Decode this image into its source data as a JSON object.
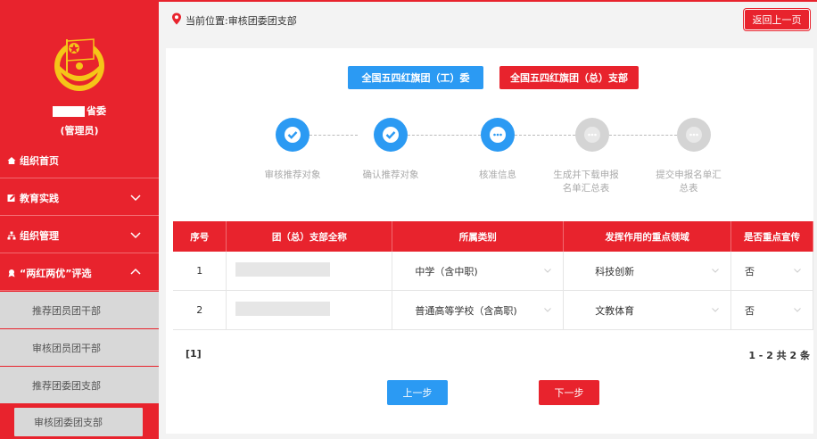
{
  "sidebar": {
    "user_suffix": "省委",
    "user_role": "(管理员)",
    "items": [
      {
        "label": "组织首页",
        "icon": "home-icon"
      },
      {
        "label": "教育实践",
        "icon": "edit-icon"
      },
      {
        "label": "组织管理",
        "icon": "org-icon"
      },
      {
        "label": "“两红两优”评选",
        "icon": "award-icon"
      }
    ],
    "sub_items": [
      {
        "label": "推荐团员团干部"
      },
      {
        "label": "审核团员团干部"
      },
      {
        "label": "推荐团委团支部"
      },
      {
        "label": "审核团委团支部"
      }
    ],
    "colors": {
      "brand": "#e8232d",
      "sub_bg": "#d8d8d8"
    }
  },
  "topbar": {
    "breadcrumb": "当前位置:审核团委团支部",
    "back_label": "返回上一页"
  },
  "toggles": {
    "blue_label": "全国五四红旗团（工）委",
    "red_label": "全国五四红旗团（总）支部"
  },
  "steps": [
    {
      "label": "审核推荐对象",
      "state": "done"
    },
    {
      "label": "确认推荐对象",
      "state": "done"
    },
    {
      "label": "核准信息",
      "state": "current"
    },
    {
      "label": "生成并下载申报名单汇总表",
      "state": "todo"
    },
    {
      "label": "提交申报名单汇总表",
      "state": "todo"
    }
  ],
  "table": {
    "headers": [
      "序号",
      "团（总）支部全称",
      "所属类别",
      "发挥作用的重点领域",
      "是否重点宣传"
    ],
    "rows": [
      {
        "index": "1",
        "category": "中学（含中职)",
        "field": "科技创新",
        "promote": "否"
      },
      {
        "index": "2",
        "category": "普通高等学校（含高职)",
        "field": "文教体育",
        "promote": "否"
      }
    ]
  },
  "pager": {
    "pages": "[1]",
    "summary": "1 - 2  共 2 条"
  },
  "buttons": {
    "prev": "上一步",
    "next": "下一步"
  },
  "colors": {
    "accent": "#2b9af3",
    "brand": "#e8232d"
  }
}
